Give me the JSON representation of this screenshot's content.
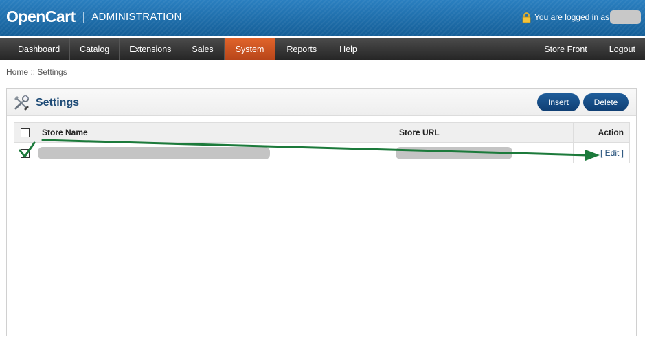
{
  "header": {
    "logo": "OpenCart",
    "separator": "|",
    "subtitle": "ADMINISTRATION",
    "login_text": "You are logged in as"
  },
  "menu": {
    "left": [
      "Dashboard",
      "Catalog",
      "Extensions",
      "Sales",
      "System",
      "Reports",
      "Help"
    ],
    "active": "System",
    "right": [
      "Store Front",
      "Logout"
    ]
  },
  "breadcrumb": {
    "home": "Home",
    "separator": " :: ",
    "current": "Settings"
  },
  "box": {
    "title": "Settings",
    "insert_label": "Insert",
    "delete_label": "Delete"
  },
  "table": {
    "headers": {
      "name": "Store Name",
      "url": "Store URL",
      "action": "Action"
    },
    "rows": [
      {
        "name": "",
        "url": "",
        "action": "Edit"
      }
    ]
  },
  "colors": {
    "header_blue": "#1b6aa5",
    "menu_dark": "#2f2f2f",
    "menu_active": "#d35525",
    "button_blue": "#164c85",
    "title_blue": "#1f4c77",
    "annotation_green": "#1c7a3b"
  },
  "icons": [
    "lock-icon",
    "settings-icon",
    "checkbox-icon",
    "check-mark-icon",
    "arrow-icon"
  ]
}
